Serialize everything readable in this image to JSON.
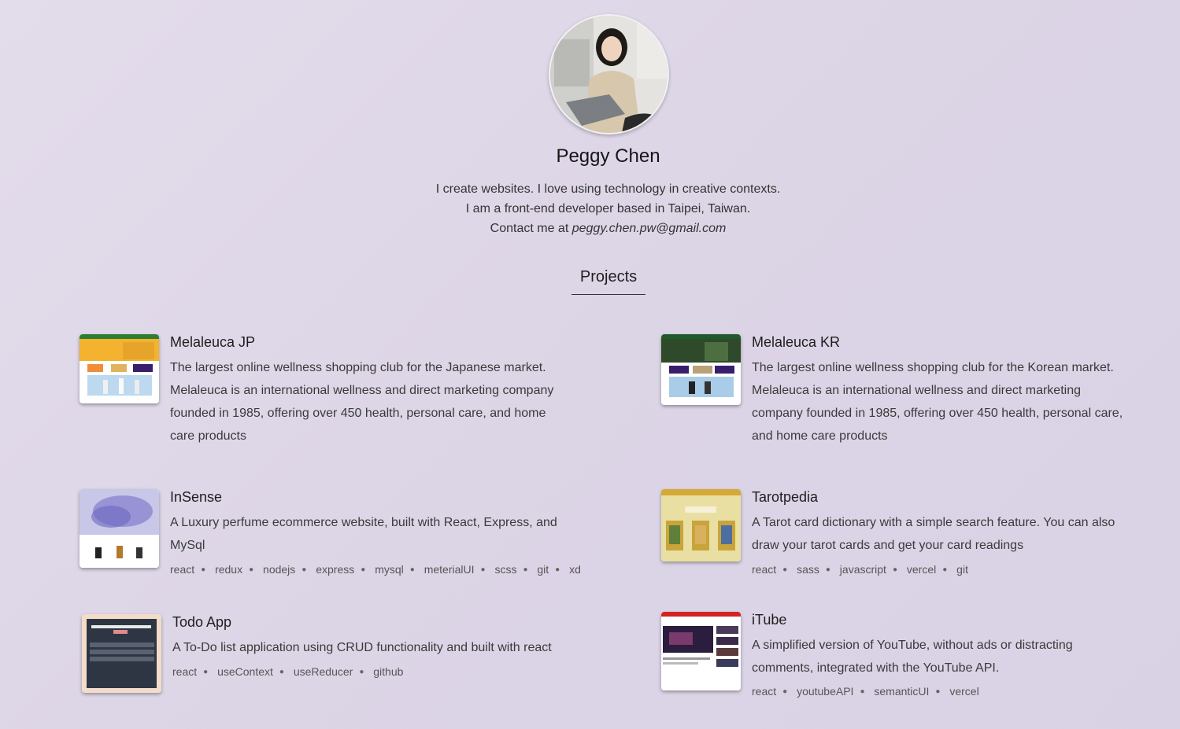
{
  "profile": {
    "name": "Peggy Chen",
    "bio_line1": "I create websites. I love using technology in creative contexts.",
    "bio_line2": "I am a front-end developer based in Taipei, Taiwan.",
    "contact_prefix": "Contact me at",
    "email": "peggy.chen.pw@gmail.com"
  },
  "projects_section": {
    "title": "Projects"
  },
  "projects": [
    {
      "title": "Melaleuca JP",
      "description": "The largest online wellness shopping club for the Japanese market. Melaleuca is an international wellness and direct marketing company founded in 1985, offering over 450 health, personal care, and home care products",
      "tags": []
    },
    {
      "title": "Melaleuca KR",
      "description": "The largest online wellness shopping club for the Korean market. Melaleuca is an international wellness and direct marketing company founded in 1985, offering over 450 health, personal care, and home care products",
      "tags": []
    },
    {
      "title": "InSense",
      "description": "A Luxury perfume ecommerce website, built with React, Express, and MySql",
      "tags": [
        "react",
        "redux",
        "nodejs",
        "express",
        "mysql",
        "meterialUI",
        "scss",
        "git",
        "xd"
      ]
    },
    {
      "title": "Tarotpedia",
      "description": "A Tarot card dictionary with a simple search feature. You can also draw your tarot cards and get your card readings",
      "tags": [
        "react",
        "sass",
        "javascript",
        "vercel",
        "git"
      ]
    },
    {
      "title": "Todo App",
      "description": "A To-Do list application using CRUD functionality and built with react",
      "tags": [
        "react",
        "useContext",
        "useReducer",
        "github"
      ]
    },
    {
      "title": "iTube",
      "description": "A simplified version of YouTube, without ads or distracting comments, integrated with the YouTube API.",
      "tags": [
        "react",
        "youtubeAPI",
        "semanticUI",
        "vercel"
      ]
    }
  ]
}
